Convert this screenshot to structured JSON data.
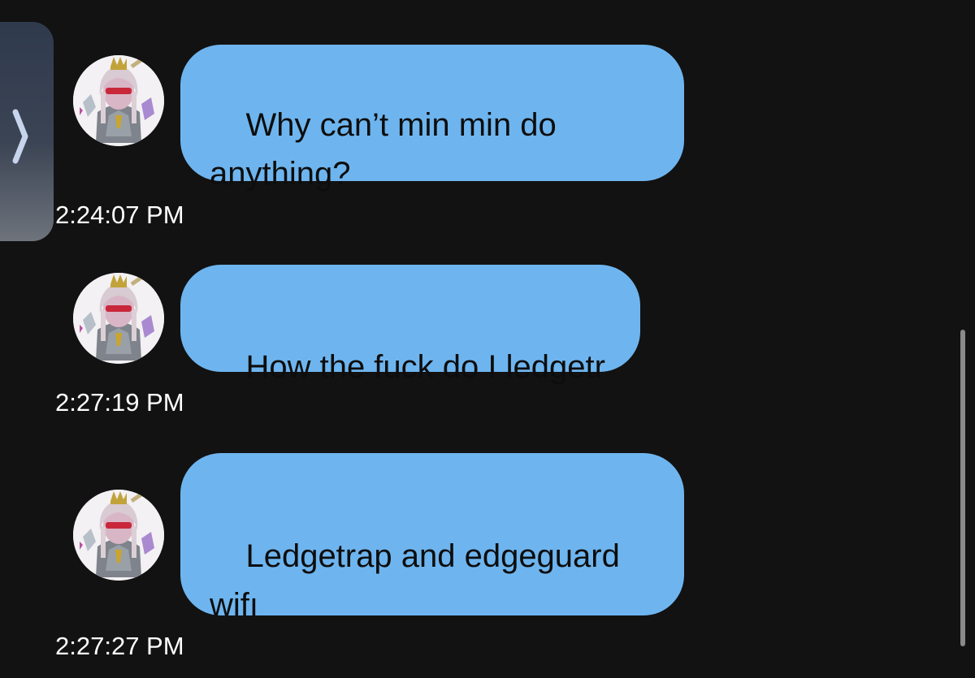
{
  "messages": [
    {
      "text": "Why can’t min min do\nanything?",
      "time": "2:24:07 PM"
    },
    {
      "text": "How the fuck do I ledgetr",
      "time": "2:27:19 PM"
    },
    {
      "text": "Ledgetrap and edgeguard\nwifı",
      "time": "2:27:27 PM"
    }
  ],
  "colors": {
    "background": "#121212",
    "bubble": "#6eb5ef",
    "text_on_bubble": "#0d0d0d",
    "timestamp": "#ffffff"
  },
  "icons": {
    "side_tab": "chevron-right-icon",
    "avatar": "character-avatar"
  }
}
